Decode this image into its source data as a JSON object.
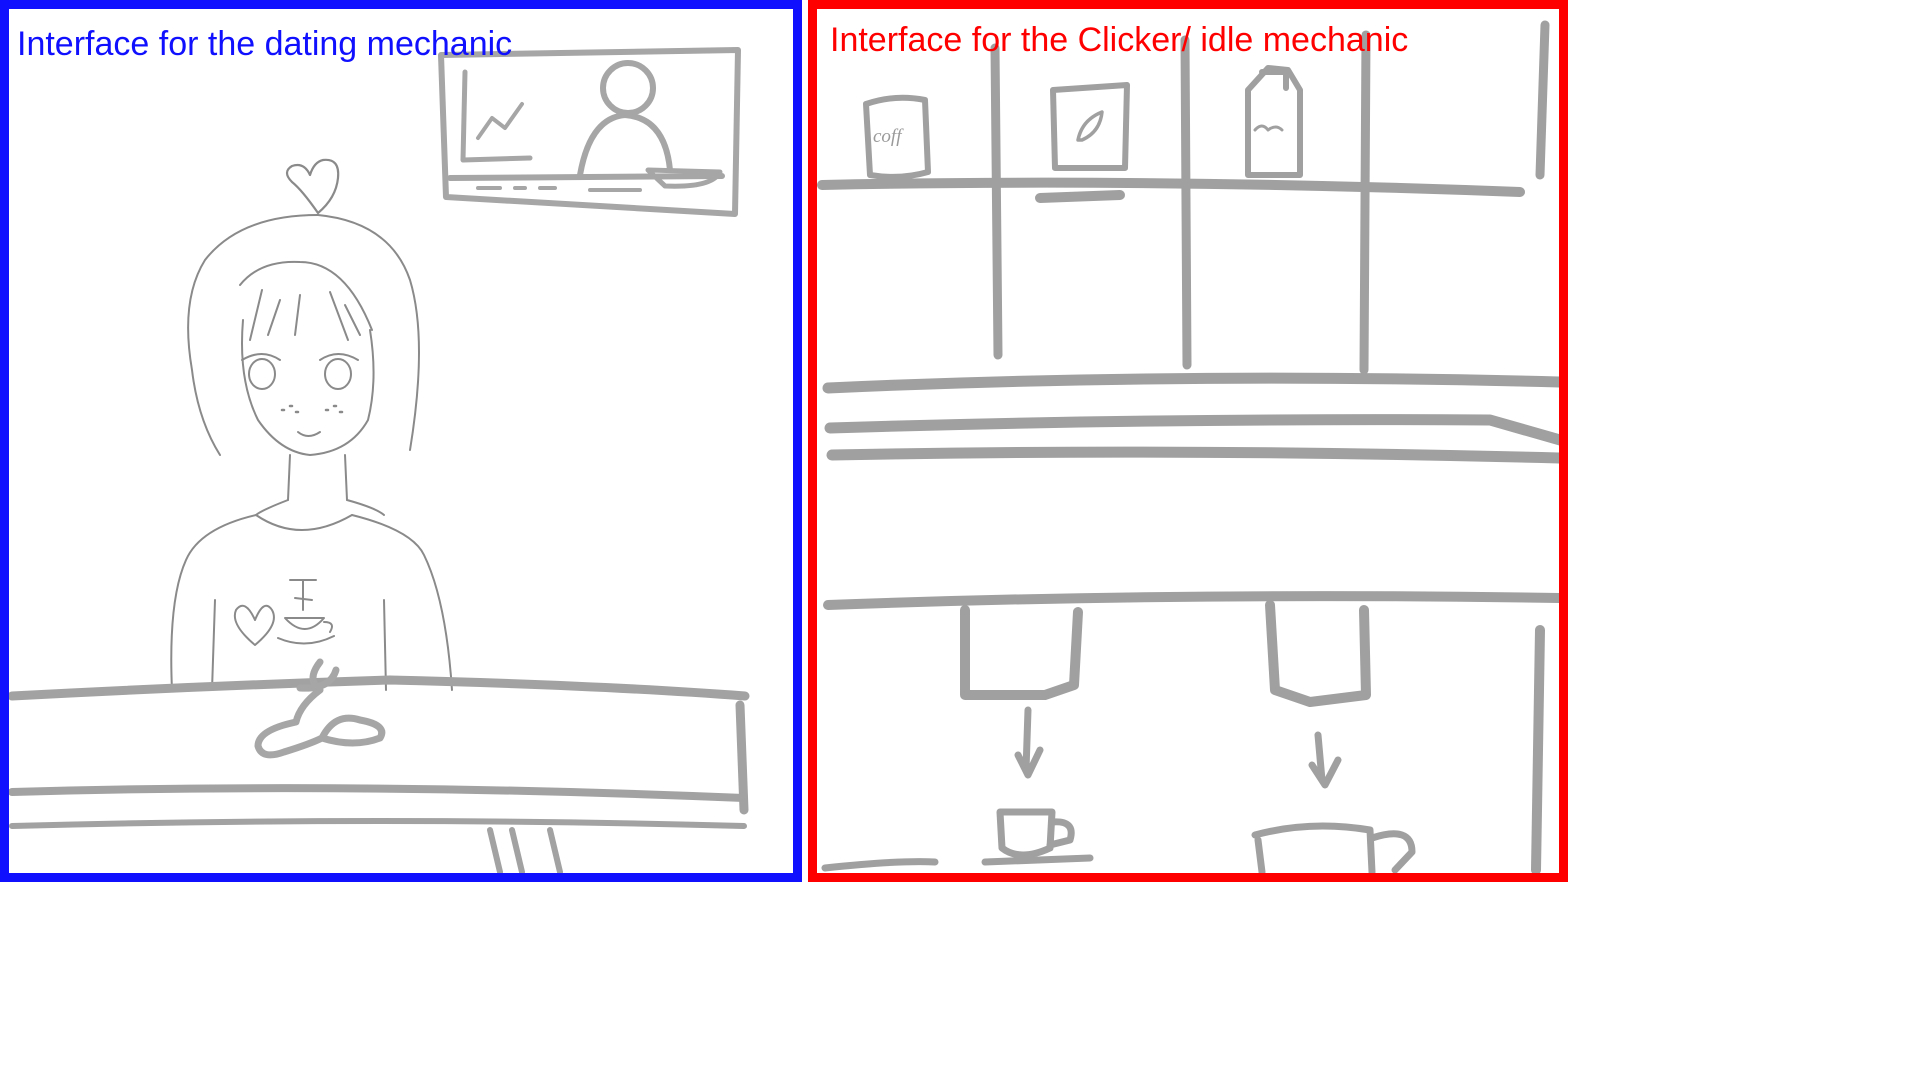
{
  "dating": {
    "title": "Interface for the dating mechanic",
    "title_color": "#1010ff",
    "border_color": "#1010ff",
    "elements": {
      "tv_screen": "tv-screen-icon",
      "character": "girl-character",
      "heart": "heart-icon",
      "counter": "counter",
      "coffee_spill": "coffee-stain-icon"
    }
  },
  "clicker": {
    "title": "Interface for the Clicker/ idle mechanic",
    "title_color": "#ff0000",
    "border_color": "#ff0000",
    "shelf_items": [
      "coffee-jar-icon",
      "tea-box-icon",
      "milk-carton-icon"
    ],
    "jar_label": "coff",
    "elements": {
      "espresso_machine": "espresso-machine",
      "cups": [
        "cup-icon",
        "mug-icon"
      ]
    }
  },
  "sketch_color": "#9a9a9a"
}
